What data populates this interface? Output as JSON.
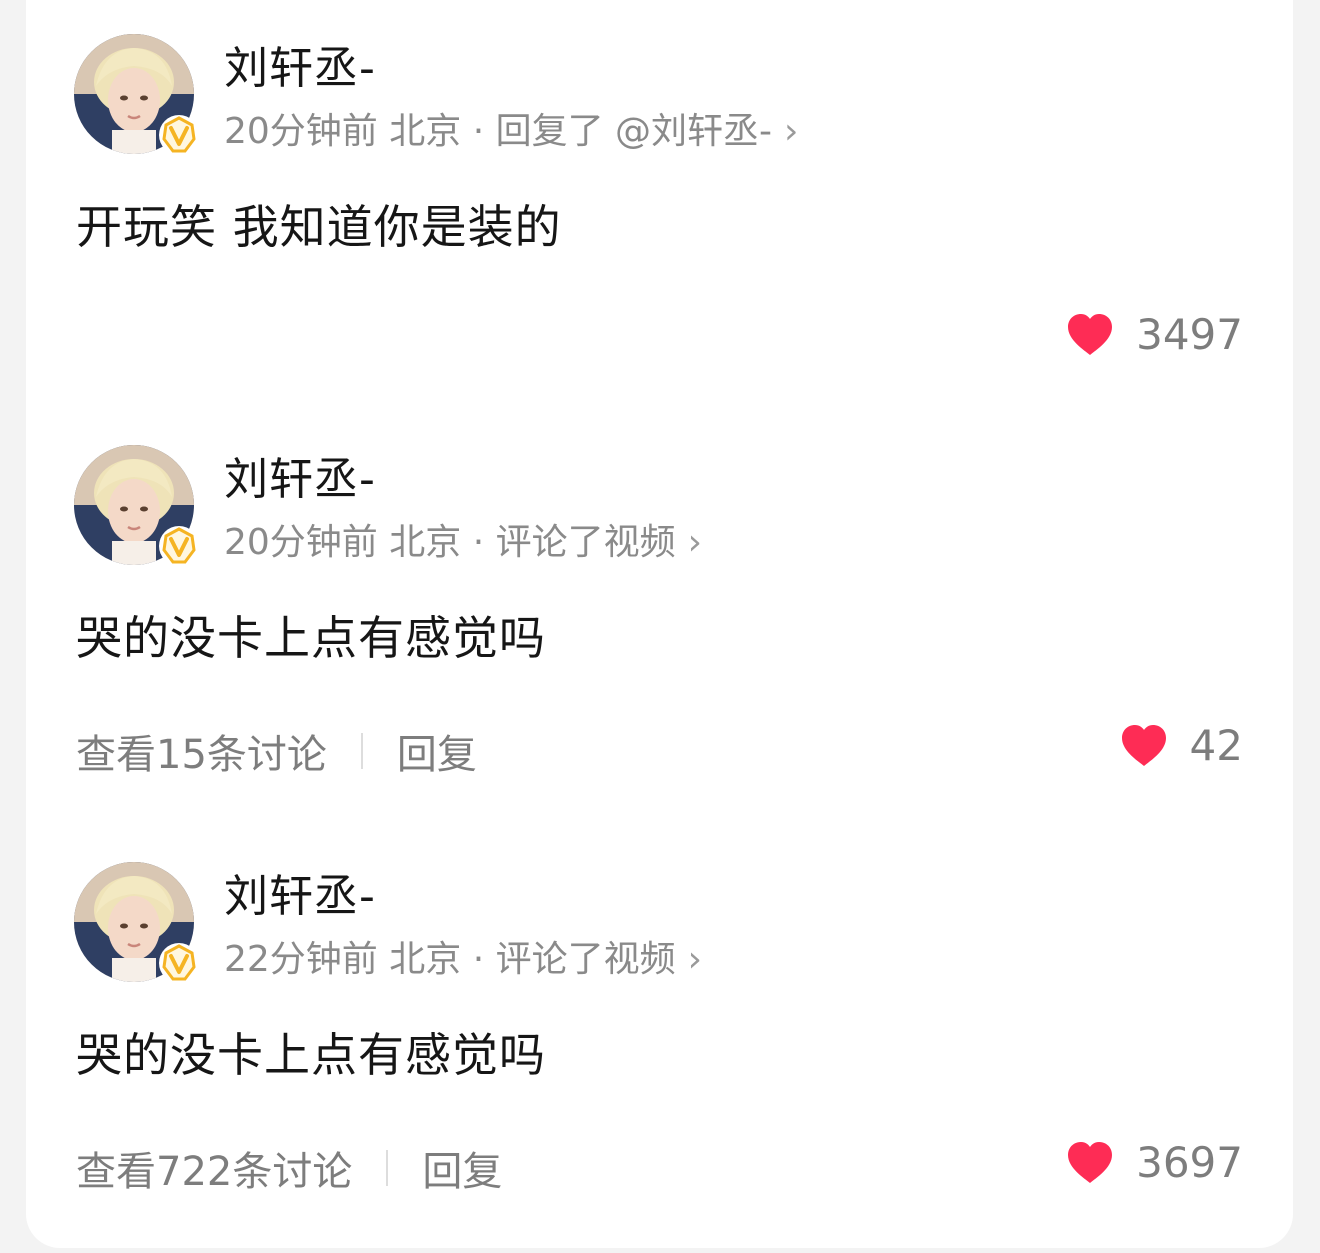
{
  "comments": [
    {
      "user_name": "刘轩丞-",
      "meta": "20分钟前 北京 · 回复了 @刘轩丞-",
      "text": "开玩笑 我知道你是装的",
      "likes": "3497",
      "view_discussion": "",
      "reply": ""
    },
    {
      "user_name": "刘轩丞-",
      "meta": "20分钟前 北京 · 评论了视频",
      "text": "哭的没卡上点有感觉吗",
      "likes": "42",
      "view_discussion": "查看15条讨论",
      "reply": "回复"
    },
    {
      "user_name": "刘轩丞-",
      "meta": "22分钟前 北京 · 评论了视频",
      "text": "哭的没卡上点有感觉吗",
      "likes": "3697",
      "view_discussion": "查看722条讨论",
      "reply": "回复"
    }
  ],
  "icons": {
    "like": "heart-icon",
    "verified": "verified-badge-icon",
    "chevron": "chevron-right-icon"
  },
  "colors": {
    "heart": "#fe2c55",
    "badge": "#f5b423",
    "meta_text": "#8a8a8a",
    "main_text": "#161616"
  }
}
